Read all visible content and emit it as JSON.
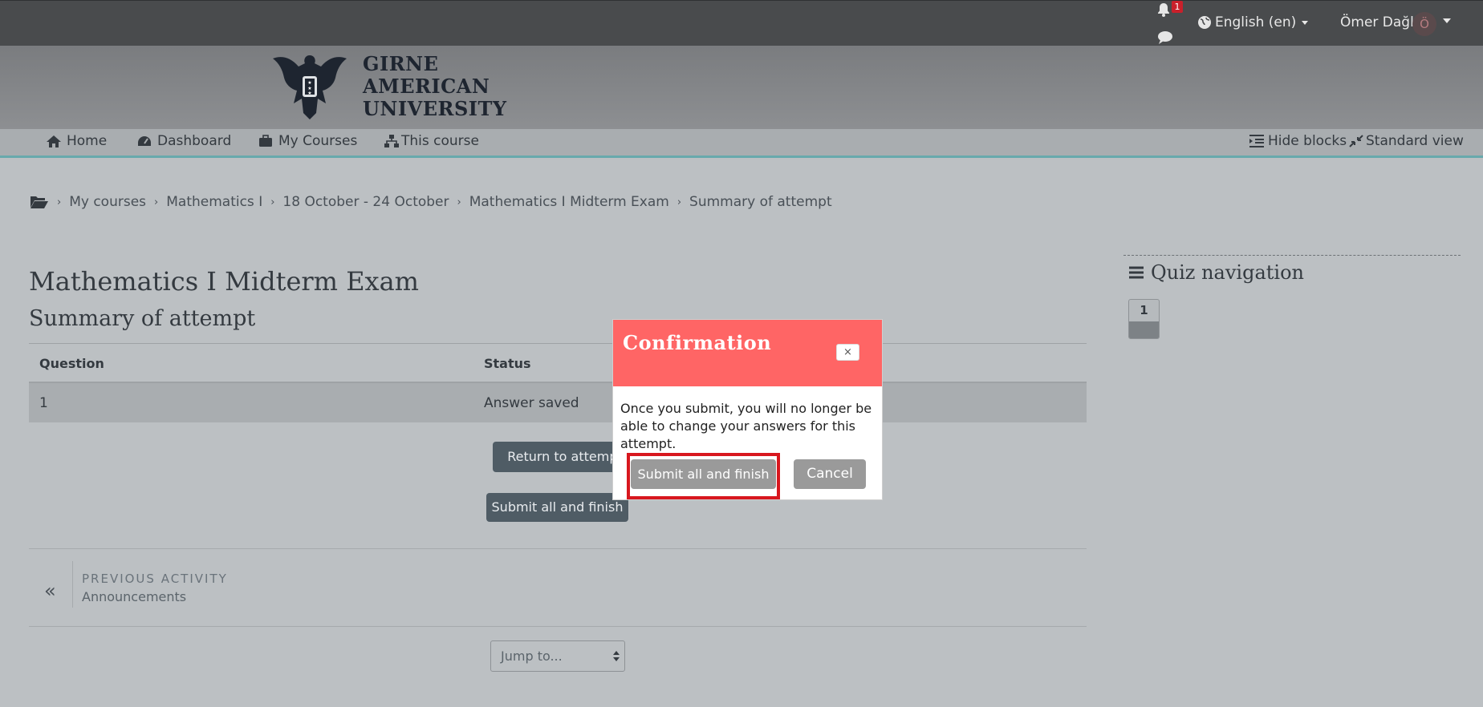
{
  "topbar": {
    "notification_count": "1",
    "language": "English (en)",
    "user_name": "Ömer Dağlı",
    "avatar_initial": "Ö"
  },
  "logo": {
    "line1": "GIRNE",
    "line2": "AMERICAN",
    "line3": "UNIVERSITY"
  },
  "nav": {
    "home": "Home",
    "dashboard": "Dashboard",
    "my_courses": "My Courses",
    "this_course": "This course",
    "hide_blocks": "Hide blocks",
    "standard_view": "Standard view"
  },
  "breadcrumb": [
    "My courses",
    "Mathematics I",
    "18 October - 24 October",
    "Mathematics I Midterm Exam",
    "Summary of attempt"
  ],
  "page": {
    "title": "Mathematics I Midterm Exam",
    "subtitle": "Summary of attempt"
  },
  "table": {
    "headers": [
      "Question",
      "Status"
    ],
    "rows": [
      [
        "1",
        "Answer saved"
      ]
    ]
  },
  "buttons": {
    "return_to_attempt": "Return to attempt",
    "submit_all": "Submit all and finish"
  },
  "prev_activity": {
    "label": "PREVIOUS ACTIVITY",
    "name": "Announcements"
  },
  "jump": {
    "label": "Jump to..."
  },
  "quiz_nav": {
    "title": "Quiz navigation",
    "question_number": "1"
  },
  "modal": {
    "title": "Confirmation",
    "close": "×",
    "body": "Once you submit, you will no longer be able to change your answers for this attempt.",
    "submit": "Submit all and finish",
    "cancel": "Cancel"
  },
  "colors": {
    "modal_header": "#ff6565",
    "focus_outline": "#d8171e",
    "nav_accent": "#68a9ac"
  }
}
